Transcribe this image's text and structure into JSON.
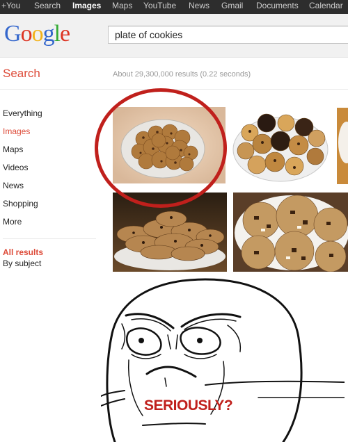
{
  "topbar": {
    "items": [
      {
        "label": "+You"
      },
      {
        "label": "Search"
      },
      {
        "label": "Images",
        "active": true
      },
      {
        "label": "Maps"
      },
      {
        "label": "YouTube"
      },
      {
        "label": "News"
      },
      {
        "label": "Gmail"
      },
      {
        "label": "Documents"
      },
      {
        "label": "Calendar"
      }
    ]
  },
  "header": {
    "logo": {
      "letters": [
        "G",
        "o",
        "o",
        "g",
        "l",
        "e"
      ],
      "colors": [
        "#3366cc",
        "#dd3322",
        "#f3b21a",
        "#3366cc",
        "#33aa33",
        "#dd3322"
      ]
    },
    "search_query": "plate of cookies"
  },
  "sidebar": {
    "title": "Search",
    "items": [
      {
        "label": "Everything"
      },
      {
        "label": "Images",
        "active": true
      },
      {
        "label": "Maps"
      },
      {
        "label": "Videos"
      },
      {
        "label": "News"
      },
      {
        "label": "Shopping"
      },
      {
        "label": "More"
      }
    ],
    "all_results": "All results",
    "by_subject": "By subject"
  },
  "results": {
    "stats": "About 29,300,000 results (0.22 seconds)"
  },
  "meme": {
    "caption": "SERIOUSLY?"
  },
  "colors": {
    "accent_red": "#dd4b39",
    "circle_red": "#c0201c",
    "topbar_bg": "#2d2d2d"
  }
}
